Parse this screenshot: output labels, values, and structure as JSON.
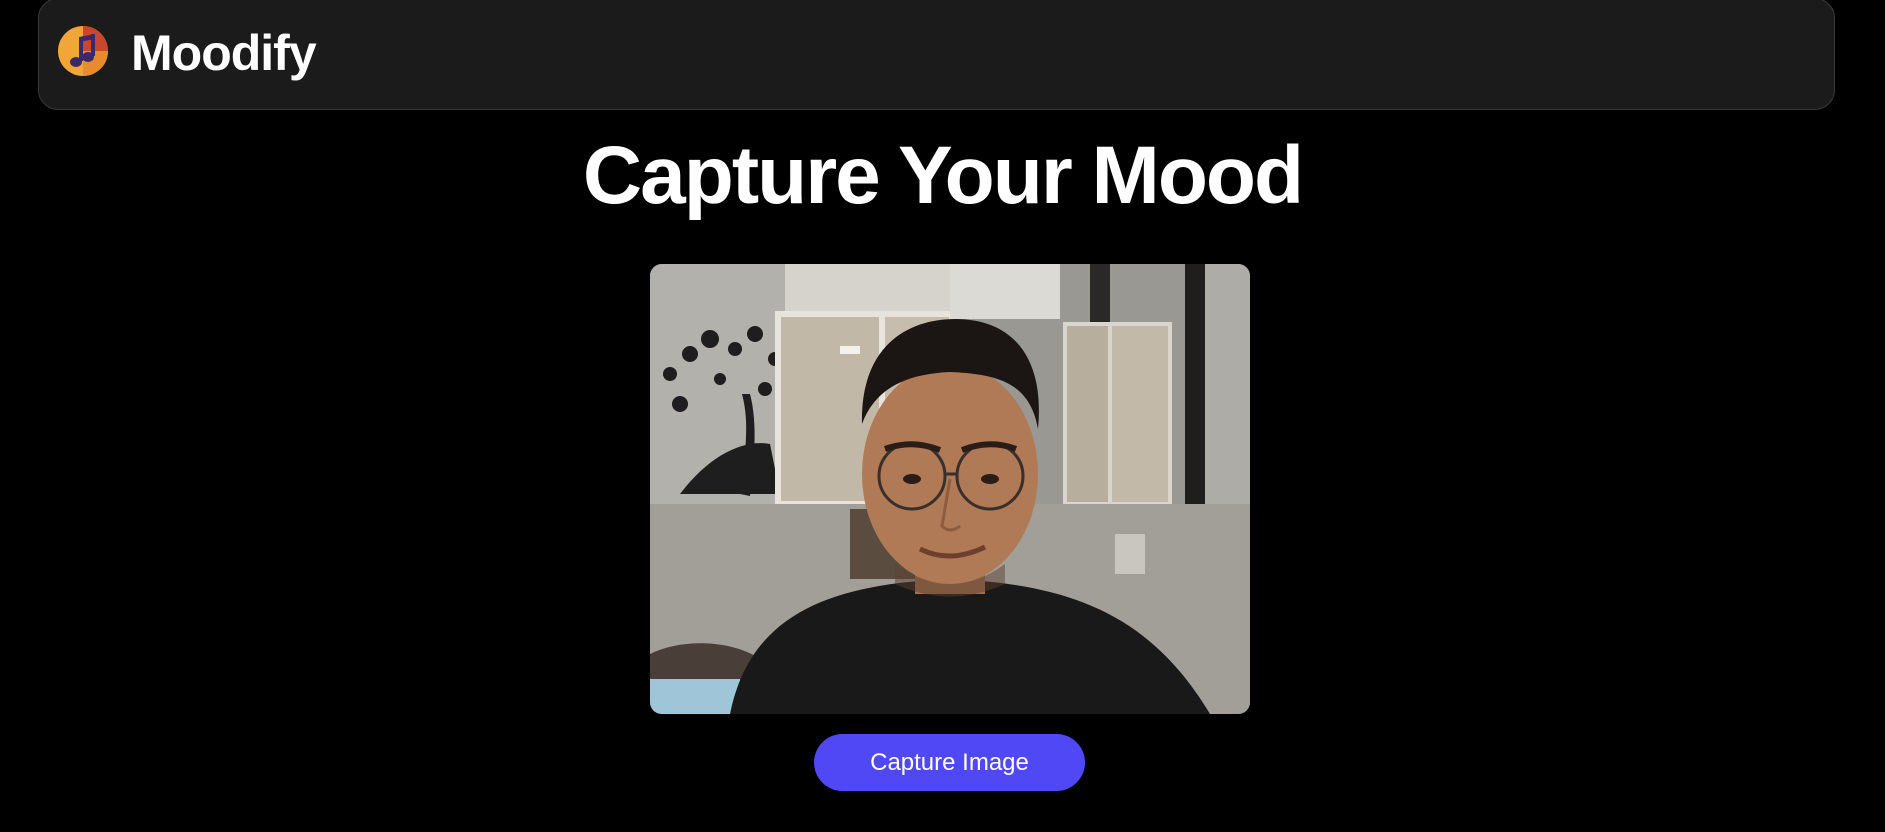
{
  "navbar": {
    "brand_name": "Moodify",
    "logo_icon": "music-mood-logo-icon"
  },
  "main": {
    "title": "Capture Your Mood",
    "camera_feed_icon": "webcam-feed",
    "capture_button_label": "Capture Image"
  },
  "colors": {
    "background": "#000000",
    "navbar_background": "#1b1b1b",
    "button_accent": "#5048f5",
    "text": "#ffffff"
  }
}
